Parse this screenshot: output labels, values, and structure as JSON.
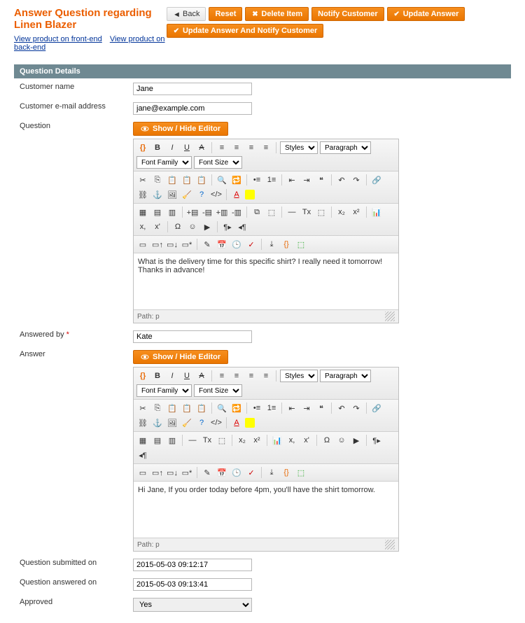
{
  "header": {
    "title": "Answer Question regarding Linen Blazer",
    "link_front": "View product on front-end",
    "link_back": "View product on back-end"
  },
  "buttons": {
    "back": "Back",
    "reset": "Reset",
    "delete": "Delete Item",
    "notify": "Notify Customer",
    "update": "Update Answer",
    "update_notify": "Update Answer And Notify Customer"
  },
  "section_title": "Question Details",
  "labels": {
    "customer_name": "Customer name",
    "customer_email": "Customer e-mail address",
    "question": "Question",
    "answered_by": "Answered by",
    "answer": "Answer",
    "submitted_on": "Question submitted on",
    "answered_on": "Question answered on",
    "approved": "Approved"
  },
  "values": {
    "customer_name": "Jane",
    "customer_email": "jane@example.com",
    "question_body": "What is the delivery time for this specific shirt? I really need it tomorrow! Thanks in advance!",
    "answered_by": "Kate",
    "answer_body": "Hi Jane, If you order today before 4pm, you'll have the shirt tomorrow.",
    "submitted_on": "2015-05-03 09:12:17",
    "answered_on": "2015-05-03 09:13:41",
    "approved": "Yes",
    "editor_path": "Path: p"
  },
  "editor": {
    "show_hide": "Show / Hide Editor",
    "styles": "Styles",
    "paragraph": "Paragraph",
    "font_family": "Font Family",
    "font_size": "Font Size"
  }
}
